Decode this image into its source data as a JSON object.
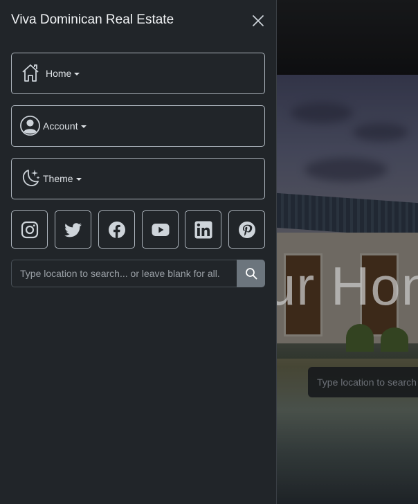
{
  "panel": {
    "title": "Viva Dominican Real Estate",
    "menus": [
      {
        "label": "Home",
        "icon": "house-icon"
      },
      {
        "label": "Account",
        "icon": "person-circle-icon"
      },
      {
        "label": "Theme",
        "icon": "moon-stars-icon"
      }
    ],
    "social": [
      "instagram-icon",
      "twitter-icon",
      "facebook-icon",
      "youtube-icon",
      "linkedin-icon",
      "pinterest-icon"
    ],
    "search": {
      "placeholder": "Type location to search... or leave blank for all."
    }
  },
  "background": {
    "hero_title": "ur Hon",
    "search_placeholder": "Type location to search"
  },
  "colors": {
    "panel_bg": "#212529",
    "border": "#adb5bd",
    "search_button": "#6c757d"
  }
}
